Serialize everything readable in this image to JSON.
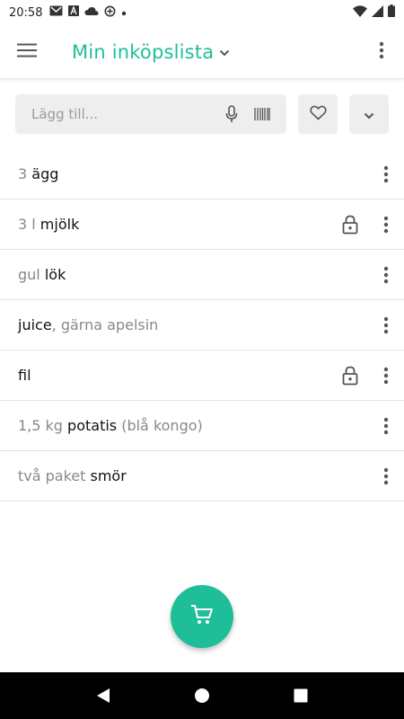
{
  "status_bar": {
    "time": "20:58",
    "icons_left": [
      "gmail-icon",
      "font-icon",
      "cloud-icon",
      "data-saver-icon",
      "dot-icon"
    ],
    "icons_right": [
      "wifi-icon",
      "signal-icon",
      "battery-icon"
    ]
  },
  "app_bar": {
    "title": "Min inköpslista"
  },
  "add_bar": {
    "placeholder": "Lägg till..."
  },
  "items": [
    {
      "qty": "3 ",
      "name": "ägg",
      "note": "",
      "locked": false
    },
    {
      "qty": "3 l ",
      "name": "mjölk",
      "note": "",
      "locked": true
    },
    {
      "qty": "gul ",
      "name": "lök",
      "note": "",
      "locked": false
    },
    {
      "qty": "",
      "name": "juice",
      "note": ", gärna apelsin",
      "locked": false
    },
    {
      "qty": "",
      "name": "fil",
      "note": "",
      "locked": true
    },
    {
      "qty": "1,5 kg ",
      "name": "potatis",
      "note": " (blå kongo)",
      "locked": false
    },
    {
      "qty": "två paket ",
      "name": "smör",
      "note": "",
      "locked": false
    }
  ],
  "colors": {
    "accent": "#1ebf98",
    "icon": "#555555"
  }
}
